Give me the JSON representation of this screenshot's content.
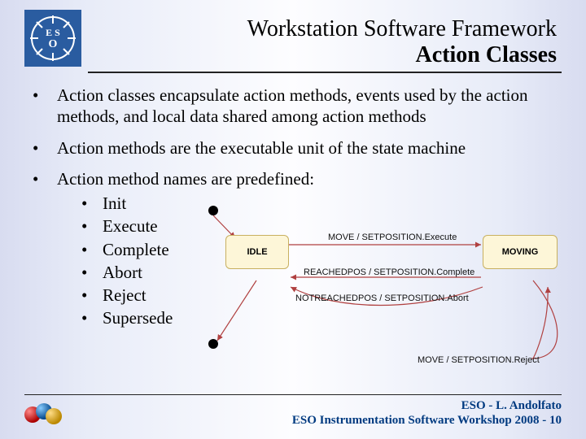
{
  "header": {
    "title_line1": "Workstation Software Framework",
    "title_line2": "Action Classes"
  },
  "bullets": {
    "b1": "Action classes encapsulate action methods, events used by the action methods, and local data shared among action methods",
    "b2": "Action methods are the executable unit of the state machine",
    "b3": "Action method names are predefined:"
  },
  "sub": {
    "s1": "Init",
    "s2": "Execute",
    "s3": "Complete",
    "s4": "Abort",
    "s5": "Reject",
    "s6": "Supersede"
  },
  "diagram": {
    "state_idle": "IDLE",
    "state_moving": "MOVING",
    "label_move": "MOVE / SETPOSITION.Execute",
    "label_reached": "REACHEDPOS / SETPOSITION.Complete",
    "label_notreached": "NOTREACHEDPOS / SETPOSITION.Abort",
    "label_reject": "MOVE / SETPOSITION.Reject"
  },
  "footer": {
    "line1": "ESO - L. Andolfato",
    "line2": "ESO Instrumentation Software Workshop 2008 - 10"
  }
}
